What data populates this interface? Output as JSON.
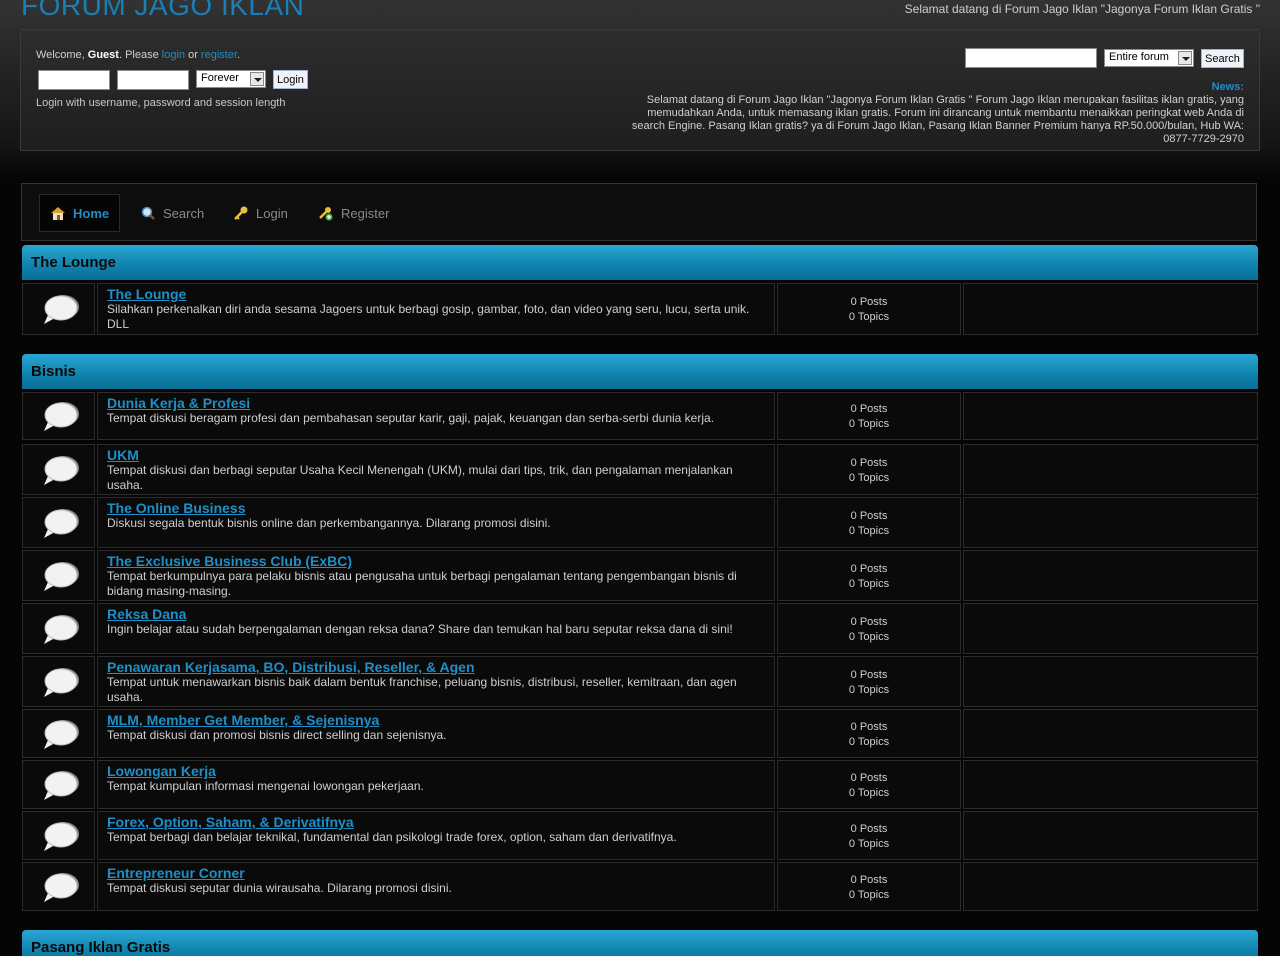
{
  "site": {
    "title": "FORUM JAGO IKLAN",
    "tagline": "Selamat datang di Forum Jago Iklan \"Jagonya Forum Iklan Gratis \""
  },
  "login": {
    "welcome_prefix": "Welcome, ",
    "guest": "Guest",
    "please": ". Please ",
    "login_link": "login",
    "or": " or ",
    "register_link": "register",
    "period": ".",
    "username_value": "",
    "password_value": "",
    "session_length": "Forever",
    "login_button": "Login",
    "hint": "Login with username, password and session length"
  },
  "search": {
    "value": "",
    "scope": "Entire forum",
    "button": "Search"
  },
  "news": {
    "label": "News:",
    "text": "Selamat datang di Forum Jago Iklan \"Jagonya Forum Iklan Gratis \" Forum Jago Iklan merupakan fasilitas iklan gratis, yang memudahkan Anda, untuk memasang iklan gratis. Forum ini dirancang untuk membantu menaikkan peringkat web Anda di search Engine. Pasang Iklan gratis? ya di Forum Jago Iklan, Pasang Iklan Banner Premium hanya RP.50.000/bulan, Hub WA: 0877-7729-2970"
  },
  "nav": {
    "items": [
      {
        "label": "Home",
        "icon": "home-icon"
      },
      {
        "label": "Search",
        "icon": "search-icon"
      },
      {
        "label": "Login",
        "icon": "key-icon"
      },
      {
        "label": "Register",
        "icon": "register-icon"
      }
    ]
  },
  "sections": [
    {
      "name": "The Lounge",
      "boards": [
        {
          "title": "The Lounge",
          "desc": "Silahkan perkenalkan diri anda sesama Jagoers untuk berbagi gosip, gambar, foto, dan video yang seru, lucu, serta unik. DLL",
          "posts": "0 Posts",
          "topics": "0 Topics"
        }
      ]
    },
    {
      "name": "Bisnis",
      "boards": [
        {
          "title": "Dunia Kerja & Profesi",
          "desc": "Tempat diskusi beragam profesi dan pembahasan seputar karir, gaji, pajak, keuangan dan serba-serbi dunia kerja.",
          "posts": "0 Posts",
          "topics": "0 Topics"
        },
        {
          "title": "UKM",
          "desc": "Tempat diskusi dan berbagi seputar Usaha Kecil Menengah (UKM), mulai dari tips, trik, dan pengalaman menjalankan usaha.",
          "posts": "0 Posts",
          "topics": "0 Topics"
        },
        {
          "title": "The Online Business",
          "desc": "Diskusi segala bentuk bisnis online dan perkembangannya. Dilarang promosi disini.",
          "posts": "0 Posts",
          "topics": "0 Topics"
        },
        {
          "title": "The Exclusive Business Club (ExBC)",
          "desc": "Tempat berkumpulnya para pelaku bisnis atau pengusaha untuk berbagi pengalaman tentang pengembangan bisnis di bidang masing-masing.",
          "posts": "0 Posts",
          "topics": "0 Topics"
        },
        {
          "title": "Reksa Dana",
          "desc": "Ingin belajar atau sudah berpengalaman dengan reksa dana? Share dan temukan hal baru seputar reksa dana di sini!",
          "posts": "0 Posts",
          "topics": "0 Topics"
        },
        {
          "title": "Penawaran Kerjasama, BO, Distribusi, Reseller, & Agen",
          "desc": "Tempat untuk menawarkan bisnis baik dalam bentuk franchise, peluang bisnis, distribusi, reseller, kemitraan, dan agen usaha.",
          "posts": "0 Posts",
          "topics": "0 Topics"
        },
        {
          "title": "MLM, Member Get Member, & Sejenisnya",
          "desc": "Tempat diskusi dan promosi bisnis direct selling dan sejenisnya.",
          "posts": "0 Posts",
          "topics": "0 Topics"
        },
        {
          "title": "Lowongan Kerja",
          "desc": "Tempat kumpulan informasi mengenai lowongan pekerjaan.",
          "posts": "0 Posts",
          "topics": "0 Topics"
        },
        {
          "title": "Forex, Option, Saham, & Derivatifnya",
          "desc": "Tempat berbagi dan belajar teknikal, fundamental dan psikologi trade forex, option, saham dan derivatifnya.",
          "posts": "0 Posts",
          "topics": "0 Topics"
        },
        {
          "title": "Entrepreneur Corner",
          "desc": "Tempat diskusi seputar dunia wirausaha. Dilarang promosi disini.",
          "posts": "0 Posts",
          "topics": "0 Topics"
        }
      ]
    },
    {
      "name": "Pasang Iklan Gratis",
      "boards": []
    }
  ],
  "colors": {
    "accent": "#1e8fc7",
    "section_header": "#1289b5",
    "background": "#050505"
  }
}
